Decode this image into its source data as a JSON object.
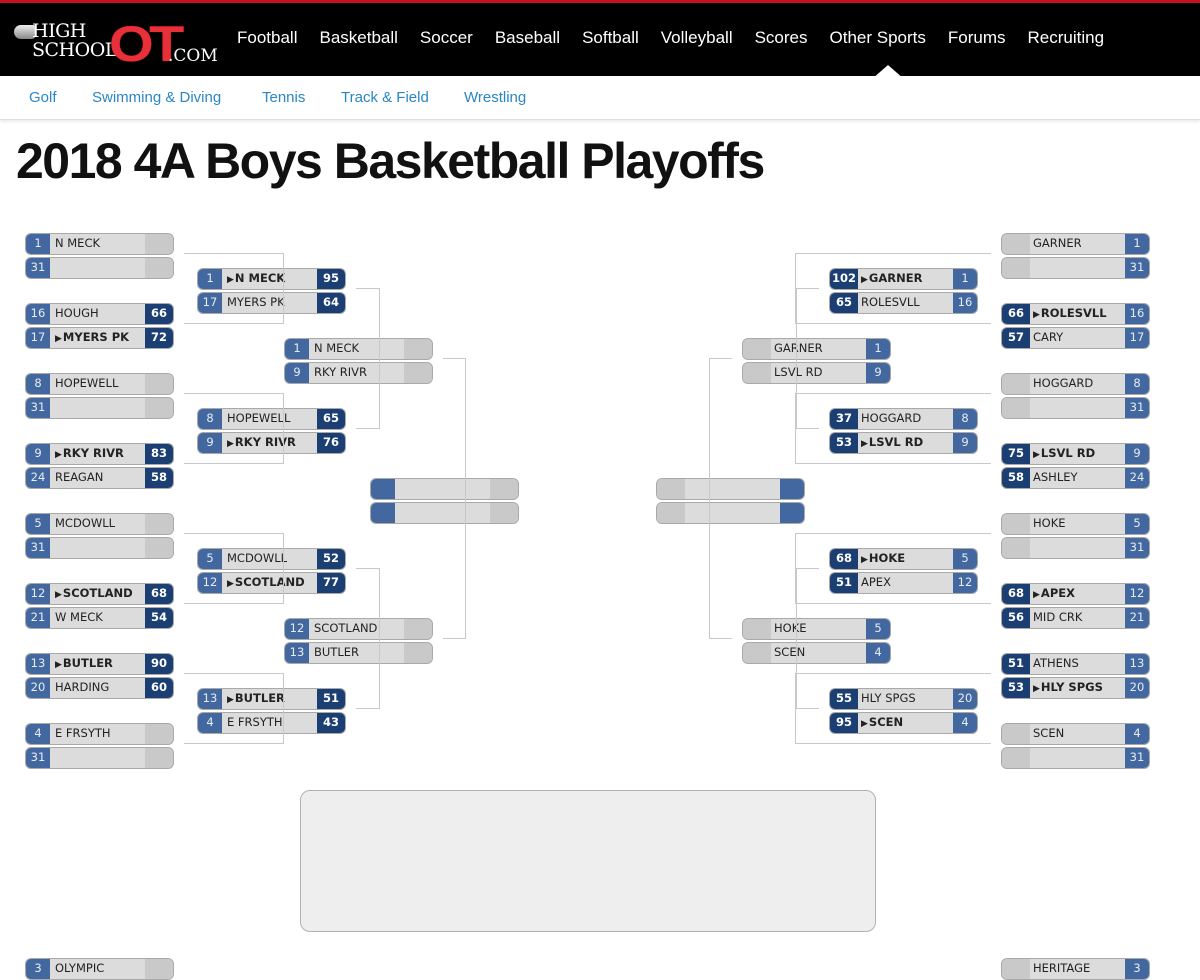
{
  "site": {
    "logo_text_top": "HIGH",
    "logo_text_bottom": "SCHOOL",
    "logo_ot": "OT",
    "logo_com": ".COM"
  },
  "main_nav": [
    "Football",
    "Basketball",
    "Soccer",
    "Baseball",
    "Softball",
    "Volleyball",
    "Scores",
    "Other Sports",
    "Forums",
    "Recruiting"
  ],
  "active_main_nav": "Other Sports",
  "sub_nav": [
    "Golf",
    "Swimming & Diving",
    "Tennis",
    "Track & Field",
    "Wrestling"
  ],
  "page_title": "2018 4A Boys Basketball Playoffs",
  "colors": {
    "brand_red": "#c8101e",
    "seed_blue": "#43689f",
    "score_navy": "#1c3f73",
    "link_blue": "#2a86c5"
  },
  "bracket": {
    "left": {
      "round1": [
        [
          {
            "seed": "1",
            "name": "N MECK",
            "score": "",
            "win": false
          },
          {
            "seed": "31",
            "name": "",
            "score": "",
            "win": false
          }
        ],
        [
          {
            "seed": "16",
            "name": "HOUGH",
            "score": "66",
            "win": false
          },
          {
            "seed": "17",
            "name": "MYERS PK",
            "score": "72",
            "win": true
          }
        ],
        [
          {
            "seed": "8",
            "name": "HOPEWELL",
            "score": "",
            "win": false
          },
          {
            "seed": "31",
            "name": "",
            "score": "",
            "win": false
          }
        ],
        [
          {
            "seed": "9",
            "name": "RKY RIVR",
            "score": "83",
            "win": true
          },
          {
            "seed": "24",
            "name": "REAGAN",
            "score": "58",
            "win": false
          }
        ],
        [
          {
            "seed": "5",
            "name": "MCDOWLL",
            "score": "",
            "win": false
          },
          {
            "seed": "31",
            "name": "",
            "score": "",
            "win": false
          }
        ],
        [
          {
            "seed": "12",
            "name": "SCOTLAND",
            "score": "68",
            "win": true
          },
          {
            "seed": "21",
            "name": "W MECK",
            "score": "54",
            "win": false
          }
        ],
        [
          {
            "seed": "13",
            "name": "BUTLER",
            "score": "90",
            "win": true
          },
          {
            "seed": "20",
            "name": "HARDING",
            "score": "60",
            "win": false
          }
        ],
        [
          {
            "seed": "4",
            "name": "E FRSYTH",
            "score": "",
            "win": false
          },
          {
            "seed": "31",
            "name": "",
            "score": "",
            "win": false
          }
        ]
      ],
      "round2": [
        [
          {
            "seed": "1",
            "name": "N MECK",
            "score": "95",
            "win": true
          },
          {
            "seed": "17",
            "name": "MYERS PK",
            "score": "64",
            "win": false
          }
        ],
        [
          {
            "seed": "8",
            "name": "HOPEWELL",
            "score": "65",
            "win": false
          },
          {
            "seed": "9",
            "name": "RKY RIVR",
            "score": "76",
            "win": true
          }
        ],
        [
          {
            "seed": "5",
            "name": "MCDOWLL",
            "score": "52",
            "win": false
          },
          {
            "seed": "12",
            "name": "SCOTLAND",
            "score": "77",
            "win": true
          }
        ],
        [
          {
            "seed": "13",
            "name": "BUTLER",
            "score": "51",
            "win": true
          },
          {
            "seed": "4",
            "name": "E FRSYTH",
            "score": "43",
            "win": false
          }
        ]
      ],
      "round3": [
        [
          {
            "seed": "1",
            "name": "N MECK",
            "score": "",
            "win": false
          },
          {
            "seed": "9",
            "name": "RKY RIVR",
            "score": "",
            "win": false
          }
        ],
        [
          {
            "seed": "12",
            "name": "SCOTLAND",
            "score": "",
            "win": false
          },
          {
            "seed": "13",
            "name": "BUTLER",
            "score": "",
            "win": false
          }
        ]
      ],
      "round4": [
        [
          {
            "seed": "",
            "name": "",
            "score": "",
            "win": false
          },
          {
            "seed": "",
            "name": "",
            "score": "",
            "win": false
          }
        ]
      ],
      "next_region_partial": {
        "seed": "3",
        "name": "OLYMPIC"
      }
    },
    "right": {
      "round1": [
        [
          {
            "seed": "1",
            "name": "GARNER",
            "score": "",
            "win": false
          },
          {
            "seed": "31",
            "name": "",
            "score": "",
            "win": false
          }
        ],
        [
          {
            "seed": "16",
            "name": "ROLESVLL",
            "score": "66",
            "win": true
          },
          {
            "seed": "17",
            "name": "CARY",
            "score": "57",
            "win": false
          }
        ],
        [
          {
            "seed": "8",
            "name": "HOGGARD",
            "score": "",
            "win": false
          },
          {
            "seed": "31",
            "name": "",
            "score": "",
            "win": false
          }
        ],
        [
          {
            "seed": "9",
            "name": "LSVL RD",
            "score": "75",
            "win": true
          },
          {
            "seed": "24",
            "name": "ASHLEY",
            "score": "58",
            "win": false
          }
        ],
        [
          {
            "seed": "5",
            "name": "HOKE",
            "score": "",
            "win": false
          },
          {
            "seed": "31",
            "name": "",
            "score": "",
            "win": false
          }
        ],
        [
          {
            "seed": "12",
            "name": "APEX",
            "score": "68",
            "win": true
          },
          {
            "seed": "21",
            "name": "MID CRK",
            "score": "56",
            "win": false
          }
        ],
        [
          {
            "seed": "13",
            "name": "ATHENS",
            "score": "51",
            "win": false
          },
          {
            "seed": "20",
            "name": "HLY SPGS",
            "score": "53",
            "win": true
          }
        ],
        [
          {
            "seed": "4",
            "name": "SCEN",
            "score": "",
            "win": false
          },
          {
            "seed": "31",
            "name": "",
            "score": "",
            "win": false
          }
        ]
      ],
      "round2": [
        [
          {
            "seed": "1",
            "name": "GARNER",
            "score": "102",
            "win": true
          },
          {
            "seed": "16",
            "name": "ROLESVLL",
            "score": "65",
            "win": false
          }
        ],
        [
          {
            "seed": "8",
            "name": "HOGGARD",
            "score": "37",
            "win": false
          },
          {
            "seed": "9",
            "name": "LSVL RD",
            "score": "53",
            "win": true
          }
        ],
        [
          {
            "seed": "5",
            "name": "HOKE",
            "score": "68",
            "win": true
          },
          {
            "seed": "12",
            "name": "APEX",
            "score": "51",
            "win": false
          }
        ],
        [
          {
            "seed": "20",
            "name": "HLY SPGS",
            "score": "55",
            "win": false
          },
          {
            "seed": "4",
            "name": "SCEN",
            "score": "95",
            "win": true
          }
        ]
      ],
      "round3": [
        [
          {
            "seed": "1",
            "name": "GARNER",
            "score": "",
            "win": false
          },
          {
            "seed": "9",
            "name": "LSVL RD",
            "score": "",
            "win": false
          }
        ],
        [
          {
            "seed": "5",
            "name": "HOKE",
            "score": "",
            "win": false
          },
          {
            "seed": "4",
            "name": "SCEN",
            "score": "",
            "win": false
          }
        ]
      ],
      "round4": [
        [
          {
            "seed": "",
            "name": "",
            "score": "",
            "win": false
          },
          {
            "seed": "",
            "name": "",
            "score": "",
            "win": false
          }
        ]
      ],
      "next_region_partial": {
        "seed": "3",
        "name": "HERITAGE"
      }
    },
    "finals": {
      "left_semifinal": [
        {
          "seed": "",
          "name": "",
          "score": ""
        },
        {
          "seed": "",
          "name": "",
          "score": ""
        }
      ],
      "championship": [
        {
          "seed": "",
          "name": "",
          "score": ""
        },
        {
          "seed": "",
          "name": "",
          "score": ""
        }
      ],
      "right_semifinal": [
        {
          "seed": "",
          "name": "",
          "score": ""
        },
        {
          "seed": "",
          "name": "",
          "score": ""
        }
      ]
    }
  }
}
